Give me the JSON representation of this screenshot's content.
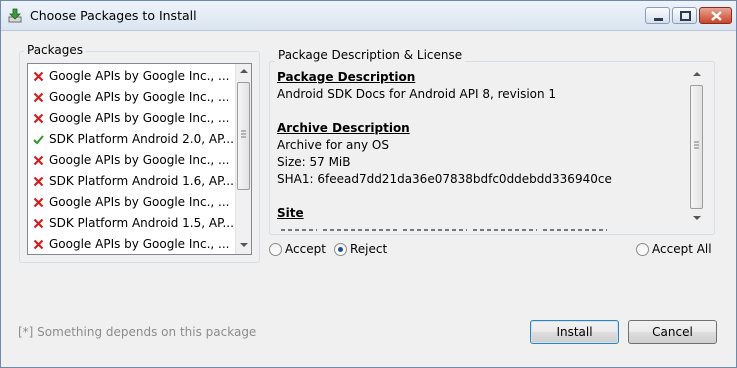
{
  "window": {
    "title": "Choose Packages to Install"
  },
  "packages": {
    "group_label": "Packages",
    "items": [
      {
        "label": "Google APIs by Google Inc., ...",
        "status": "rejected"
      },
      {
        "label": "Google APIs by Google Inc., ...",
        "status": "rejected"
      },
      {
        "label": "Google APIs by Google Inc., ...",
        "status": "rejected"
      },
      {
        "label": "SDK Platform Android 2.0, AP...",
        "status": "accepted"
      },
      {
        "label": "Google APIs by Google Inc., ...",
        "status": "rejected"
      },
      {
        "label": "SDK Platform Android 1.6, AP...",
        "status": "rejected"
      },
      {
        "label": "Google APIs by Google Inc., ...",
        "status": "rejected"
      },
      {
        "label": "SDK Platform Android 1.5, AP...",
        "status": "rejected"
      },
      {
        "label": "Google APIs by Google Inc., ...",
        "status": "rejected"
      }
    ]
  },
  "description": {
    "group_label": "Package Description & License",
    "package_heading": "Package Description",
    "package_text": "Android SDK Docs for Android API 8, revision 1",
    "archive_heading": "Archive Description",
    "archive_text": "Archive for any OS",
    "size_text": "Size: 57 MiB",
    "sha_text": "SHA1: 6feead7dd21da36e07838bdfc0ddebdd336940ce",
    "site_heading": "Site"
  },
  "options": {
    "accept_label": "Accept",
    "reject_label": "Reject",
    "accept_all_label": "Accept All",
    "selected": "reject"
  },
  "footer": {
    "note": "[*] Something depends on this package",
    "install_label": "Install",
    "cancel_label": "Cancel"
  },
  "colors": {
    "reject_mark": "#d3201f",
    "accept_mark": "#2e9a2e"
  }
}
